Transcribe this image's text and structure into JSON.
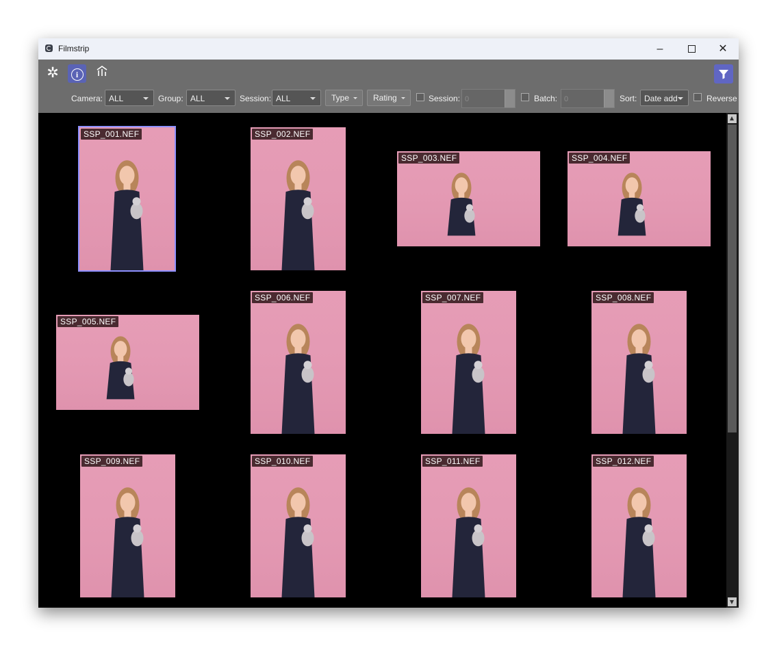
{
  "window": {
    "title": "Filmstrip",
    "controls": {
      "minimize": "–",
      "maximize": "",
      "close": "✕"
    }
  },
  "toolbar": {
    "settings_icon": "gear-icon",
    "info_icon": "info-icon",
    "stats_icon": "chart-icon",
    "filter_icon": "filter-icon",
    "camera": {
      "label": "Camera:",
      "value": "ALL"
    },
    "group": {
      "label": "Group:",
      "value": "ALL"
    },
    "session_select": {
      "label": "Session:",
      "value": "ALL"
    },
    "type_button": "Type",
    "rating_button": "Rating",
    "session_filter": {
      "label": "Session:",
      "value": "0",
      "checked": false
    },
    "batch_filter": {
      "label": "Batch:",
      "value": "0",
      "checked": false
    },
    "sort": {
      "label": "Sort:",
      "value": "Date add"
    },
    "reverse": {
      "label": "Reverse",
      "checked": false
    },
    "accent_color": "#5a63b5"
  },
  "thumbnails": [
    {
      "filename": "SSP_001.NEF",
      "orientation": "portrait",
      "selected": true
    },
    {
      "filename": "SSP_002.NEF",
      "orientation": "portrait",
      "selected": false
    },
    {
      "filename": "SSP_003.NEF",
      "orientation": "landscape",
      "selected": false
    },
    {
      "filename": "SSP_004.NEF",
      "orientation": "landscape",
      "selected": false
    },
    {
      "filename": "SSP_005.NEF",
      "orientation": "landscape",
      "selected": false
    },
    {
      "filename": "SSP_006.NEF",
      "orientation": "portrait",
      "selected": false
    },
    {
      "filename": "SSP_007.NEF",
      "orientation": "portrait",
      "selected": false
    },
    {
      "filename": "SSP_008.NEF",
      "orientation": "portrait",
      "selected": false
    },
    {
      "filename": "SSP_009.NEF",
      "orientation": "portrait",
      "selected": false
    },
    {
      "filename": "SSP_010.NEF",
      "orientation": "portrait",
      "selected": false
    },
    {
      "filename": "SSP_011.NEF",
      "orientation": "portrait",
      "selected": false
    },
    {
      "filename": "SSP_012.NEF",
      "orientation": "portrait",
      "selected": false
    }
  ],
  "colors": {
    "backdrop": "#e59ab4",
    "dress": "#23253a",
    "skin": "#f2c7ad",
    "hair": "#b8855a",
    "label_bg": "#4a2a30",
    "selection": "#8d90ff"
  }
}
